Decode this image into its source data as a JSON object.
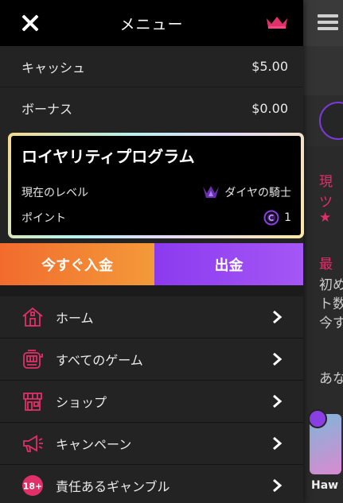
{
  "header": {
    "title": "メニュー"
  },
  "balances": {
    "cash": {
      "label": "キャッシュ",
      "value": "$5.00"
    },
    "bonus": {
      "label": "ボーナス",
      "value": "$0.00"
    }
  },
  "loyalty": {
    "title": "ロイヤリティプログラム",
    "level_label": "現在のレベル",
    "level_value": "ダイヤの騎士",
    "points_label": "ポイント",
    "points_value": "1"
  },
  "actions": {
    "deposit_label": "今すぐ入金",
    "withdraw_label": "出金"
  },
  "nav": {
    "items": [
      {
        "label": "ホーム",
        "icon": "home-icon"
      },
      {
        "label": "すべてのゲーム",
        "icon": "slot-machine-icon"
      },
      {
        "label": "ショップ",
        "icon": "shop-icon"
      },
      {
        "label": "キャンペーン",
        "icon": "megaphone-icon"
      },
      {
        "label": "責任あるギャンブル",
        "icon": "age-18-icon"
      }
    ]
  },
  "background_page": {
    "fragments": [
      "現",
      "ツ",
      "★",
      "最",
      "初め",
      "ト数",
      "今す",
      "あな",
      "Haw"
    ]
  },
  "colors": {
    "accent_pink": "#e0306a",
    "deposit_orange": "#f26b2e",
    "withdraw_purple": "#9a49f2"
  }
}
